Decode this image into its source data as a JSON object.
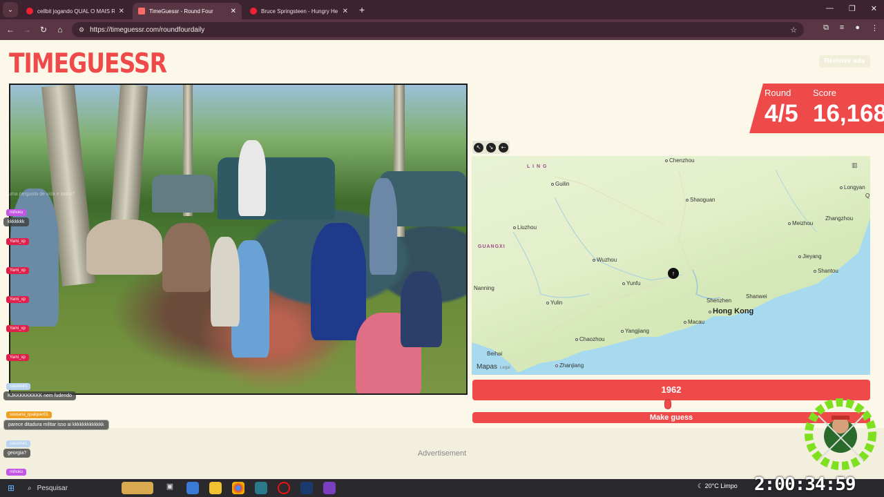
{
  "browser": {
    "tabs": [
      {
        "title": "cellbit jogando QUAL O MAIS R",
        "active": false
      },
      {
        "title": "TimeGuessr - Round Four",
        "active": true
      },
      {
        "title": "Bruce Springsteen - Hungry He",
        "active": false
      }
    ],
    "url": "https://timeguessr.com/roundfourdaily"
  },
  "page": {
    "logo": "TIMEGUESSR",
    "remove_ads": "Remove ads",
    "round_label": "Round",
    "round_value": "4/5",
    "score_label": "Score",
    "score_value": "16,168",
    "year": "1962",
    "make_guess": "Make guess",
    "advertisement": "Advertisement",
    "map": {
      "provider": "Mapas",
      "legal": "Legal",
      "region": "GUANGXI",
      "cities": {
        "chenzhou": "Chenzhou",
        "guilin": "Guilin",
        "longyan": "Longyan",
        "shaoguan": "Shaoguan",
        "liuzhou": "Liuzhou",
        "meizhou": "Meizhou",
        "zhangzhou": "Zhangzhou",
        "wuzhou": "Wuzhou",
        "jieyang": "Jieyang",
        "shantou": "Shantou",
        "yunfu": "Yunfu",
        "nanning": "Nanning",
        "yulin": "Yulin",
        "shenzhen": "Shenzhen",
        "shanwei": "Shanwei",
        "hongkong": "Hong Kong",
        "macau": "Macau",
        "yangjiang": "Yangjiang",
        "chaozhou": "Chaozhou",
        "beihai": "Beihai",
        "zhanjiang": "Zhanjiang",
        "edge_q": "Q",
        "edge_ling": "L I N G"
      }
    }
  },
  "chat": {
    "ghost": "uma pergunta de vida e todos?",
    "messages": [
      {
        "user": "mihoku",
        "text": "kkkkkkk",
        "color": "#c455e6"
      },
      {
        "user": "Yami_xp",
        "text": "",
        "color": "#e0204a"
      },
      {
        "user": "Yami_xp",
        "text": "",
        "color": "#e0204a"
      },
      {
        "user": "Yami_xp",
        "text": "",
        "color": "#e0204a"
      },
      {
        "user": "Yami_xp",
        "text": "",
        "color": "#e0204a"
      },
      {
        "user": "Yami_xp",
        "text": "",
        "color": "#e0204a"
      },
      {
        "user": "cassimir1",
        "text": "KJKKKKKKKKK nem fudendo",
        "color": "#b9d3f0"
      },
      {
        "user": "sousana_qualquer01",
        "text": "parece ditadura militar isso ai kkkkkkkkkkkkk",
        "color": "#f0a020"
      },
      {
        "user": "cassimir1",
        "text": "georgia?",
        "color": "#b9d3f0"
      },
      {
        "user": "mihoku",
        "text": "",
        "color": "#c455e6"
      }
    ]
  },
  "taskbar": {
    "search": "Pesquisar",
    "weather": "20°C  Limpo",
    "clock": "2:00:34:59"
  },
  "colors": {
    "accent": "#ef4a4a",
    "page_bg": "#fbf8ea"
  }
}
